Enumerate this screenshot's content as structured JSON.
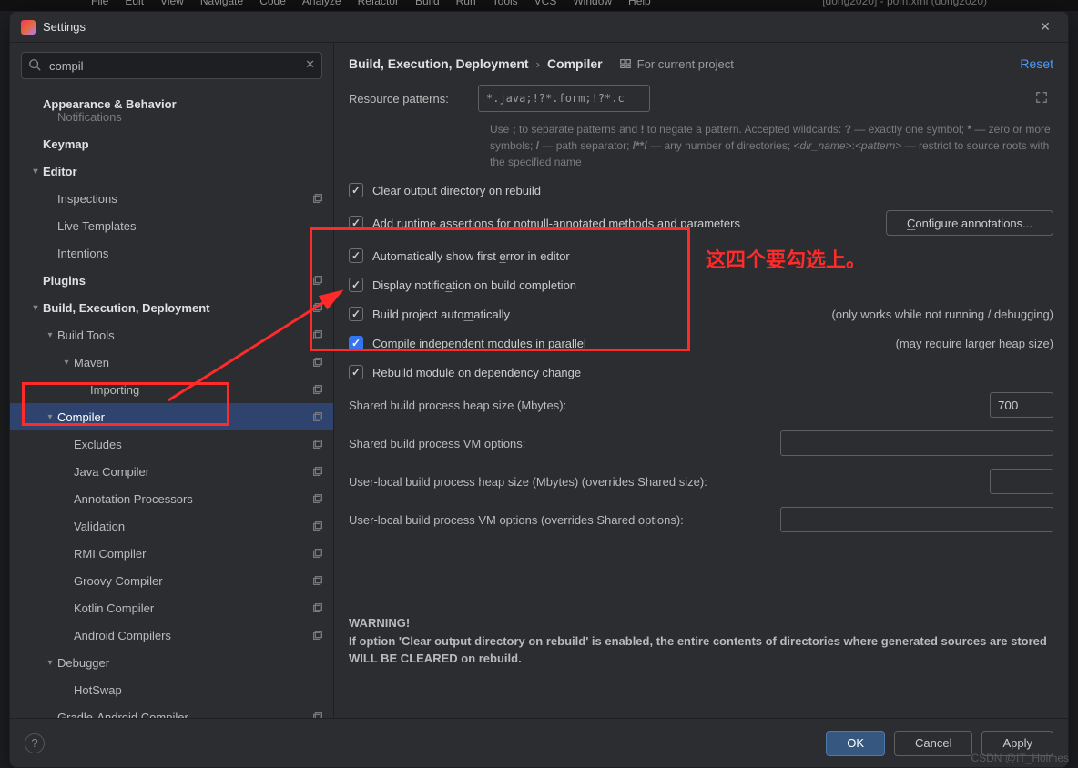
{
  "menubar": [
    "File",
    "Edit",
    "View",
    "Navigate",
    "Code",
    "Analyze",
    "Refactor",
    "Build",
    "Run",
    "Tools",
    "VCS",
    "Window",
    "Help"
  ],
  "menubar_project": "[dong2020] - pom.xml (dong2020)",
  "dialog": {
    "title": "Settings"
  },
  "search": {
    "value": "compil"
  },
  "sidebar": {
    "items": [
      {
        "label": "Appearance & Behavior",
        "bold": true,
        "indent": 0,
        "arrow": ""
      },
      {
        "label": "Notifications",
        "bold": false,
        "indent": 1,
        "arrow": "",
        "faded": true
      },
      {
        "label": "Keymap",
        "bold": true,
        "indent": 0,
        "arrow": ""
      },
      {
        "label": "Editor",
        "bold": true,
        "indent": 0,
        "arrow": "v"
      },
      {
        "label": "Inspections",
        "bold": false,
        "indent": 1,
        "arrow": "",
        "dup": true
      },
      {
        "label": "Live Templates",
        "bold": false,
        "indent": 1,
        "arrow": ""
      },
      {
        "label": "Intentions",
        "bold": false,
        "indent": 1,
        "arrow": ""
      },
      {
        "label": "Plugins",
        "bold": true,
        "indent": 0,
        "arrow": "",
        "dup": true
      },
      {
        "label": "Build, Execution, Deployment",
        "bold": true,
        "indent": 0,
        "arrow": "v",
        "dup": true
      },
      {
        "label": "Build Tools",
        "bold": false,
        "indent": 1,
        "arrow": "v",
        "dup": true
      },
      {
        "label": "Maven",
        "bold": false,
        "indent": 2,
        "arrow": "v",
        "dup": true
      },
      {
        "label": "Importing",
        "bold": false,
        "indent": 3,
        "arrow": "",
        "dup": true
      },
      {
        "label": "Compiler",
        "bold": false,
        "indent": 1,
        "arrow": "v",
        "dup": true,
        "selected": true
      },
      {
        "label": "Excludes",
        "bold": false,
        "indent": 2,
        "arrow": "",
        "dup": true
      },
      {
        "label": "Java Compiler",
        "bold": false,
        "indent": 2,
        "arrow": "",
        "dup": true
      },
      {
        "label": "Annotation Processors",
        "bold": false,
        "indent": 2,
        "arrow": "",
        "dup": true
      },
      {
        "label": "Validation",
        "bold": false,
        "indent": 2,
        "arrow": "",
        "dup": true
      },
      {
        "label": "RMI Compiler",
        "bold": false,
        "indent": 2,
        "arrow": "",
        "dup": true
      },
      {
        "label": "Groovy Compiler",
        "bold": false,
        "indent": 2,
        "arrow": "",
        "dup": true
      },
      {
        "label": "Kotlin Compiler",
        "bold": false,
        "indent": 2,
        "arrow": "",
        "dup": true
      },
      {
        "label": "Android Compilers",
        "bold": false,
        "indent": 2,
        "arrow": "",
        "dup": true
      },
      {
        "label": "Debugger",
        "bold": false,
        "indent": 1,
        "arrow": "v"
      },
      {
        "label": "HotSwap",
        "bold": false,
        "indent": 2,
        "arrow": ""
      },
      {
        "label": "Gradle-Android Compiler",
        "bold": false,
        "indent": 1,
        "arrow": "",
        "dup": true
      }
    ]
  },
  "breadcrumb": {
    "parent": "Build, Execution, Deployment",
    "current": "Compiler",
    "badge": "For current project",
    "reset": "Reset"
  },
  "resource": {
    "label": "Resource patterns:",
    "value": "*.java;!?*.form;!?*.class;!?*.groovy;!?*.scala;!?*.flex;!?*.kt;!?*.clj;!?*.aj",
    "hint_pre": "Use ",
    "hint_b1": ";",
    "hint_mid1": " to separate patterns and ",
    "hint_b2": "!",
    "hint_mid2": " to negate a pattern. Accepted wildcards: ",
    "hint_b3": "?",
    "hint_mid3": " — exactly one symbol; ",
    "hint_b4": "*",
    "hint_mid4": " — zero or more symbols; ",
    "hint_b5": "/",
    "hint_mid5": " — path separator; ",
    "hint_b6": "/**/",
    "hint_mid6": " — any number of directories; ",
    "hint_i1": "<dir_name>",
    "hint_colon": ":",
    "hint_i2": "<pattern>",
    "hint_end": " — restrict to source roots with the specified name"
  },
  "checks": {
    "c1": {
      "label_pre": "C",
      "label_u": "l",
      "label_post": "ear output directory on rebuild",
      "checked": true
    },
    "c2": {
      "label_pre": "Add runtime ",
      "label_u": "a",
      "label_post": "ssertions for notnull-annotated methods and parameters",
      "checked": true,
      "btn": "Configure annotations..."
    },
    "c3": {
      "label_pre": "Automatically show first ",
      "label_u": "e",
      "label_post": "rror in editor",
      "checked": true
    },
    "c4": {
      "label_pre": "Display notific",
      "label_u": "a",
      "label_post": "tion on build completion",
      "checked": true
    },
    "c5": {
      "label_pre": "Build project auto",
      "label_u": "m",
      "label_post": "atically",
      "checked": true,
      "side": "(only works while not running / debugging)"
    },
    "c6": {
      "label_pre": "Compile independent ",
      "label_u": "m",
      "label_post": "odules in parallel",
      "checked": true,
      "side": "(may require larger heap size)",
      "highlighted": true
    },
    "c7": {
      "label_pre": "Rebuild module on dependency change",
      "label_u": "",
      "label_post": "",
      "checked": true
    }
  },
  "fields": {
    "f1": {
      "label": "Shared build process heap size (Mbytes):",
      "value": "700",
      "wide": false
    },
    "f2": {
      "label": "Shared build process VM options:",
      "value": "",
      "wide": true
    },
    "f3": {
      "label": "User-local build process heap size (Mbytes) (overrides Shared size):",
      "value": "",
      "wide": false
    },
    "f4": {
      "label": "User-local build process VM options (overrides Shared options):",
      "value": "",
      "wide": true
    }
  },
  "warning": {
    "title": "WARNING!",
    "text": "If option 'Clear output directory on rebuild' is enabled, the entire contents of directories where generated sources are stored WILL BE CLEARED on rebuild."
  },
  "footer": {
    "ok": "OK",
    "cancel": "Cancel",
    "apply": "Apply"
  },
  "annotation": "这四个要勾选上。",
  "watermark": "CSDN @IT_Holmes"
}
